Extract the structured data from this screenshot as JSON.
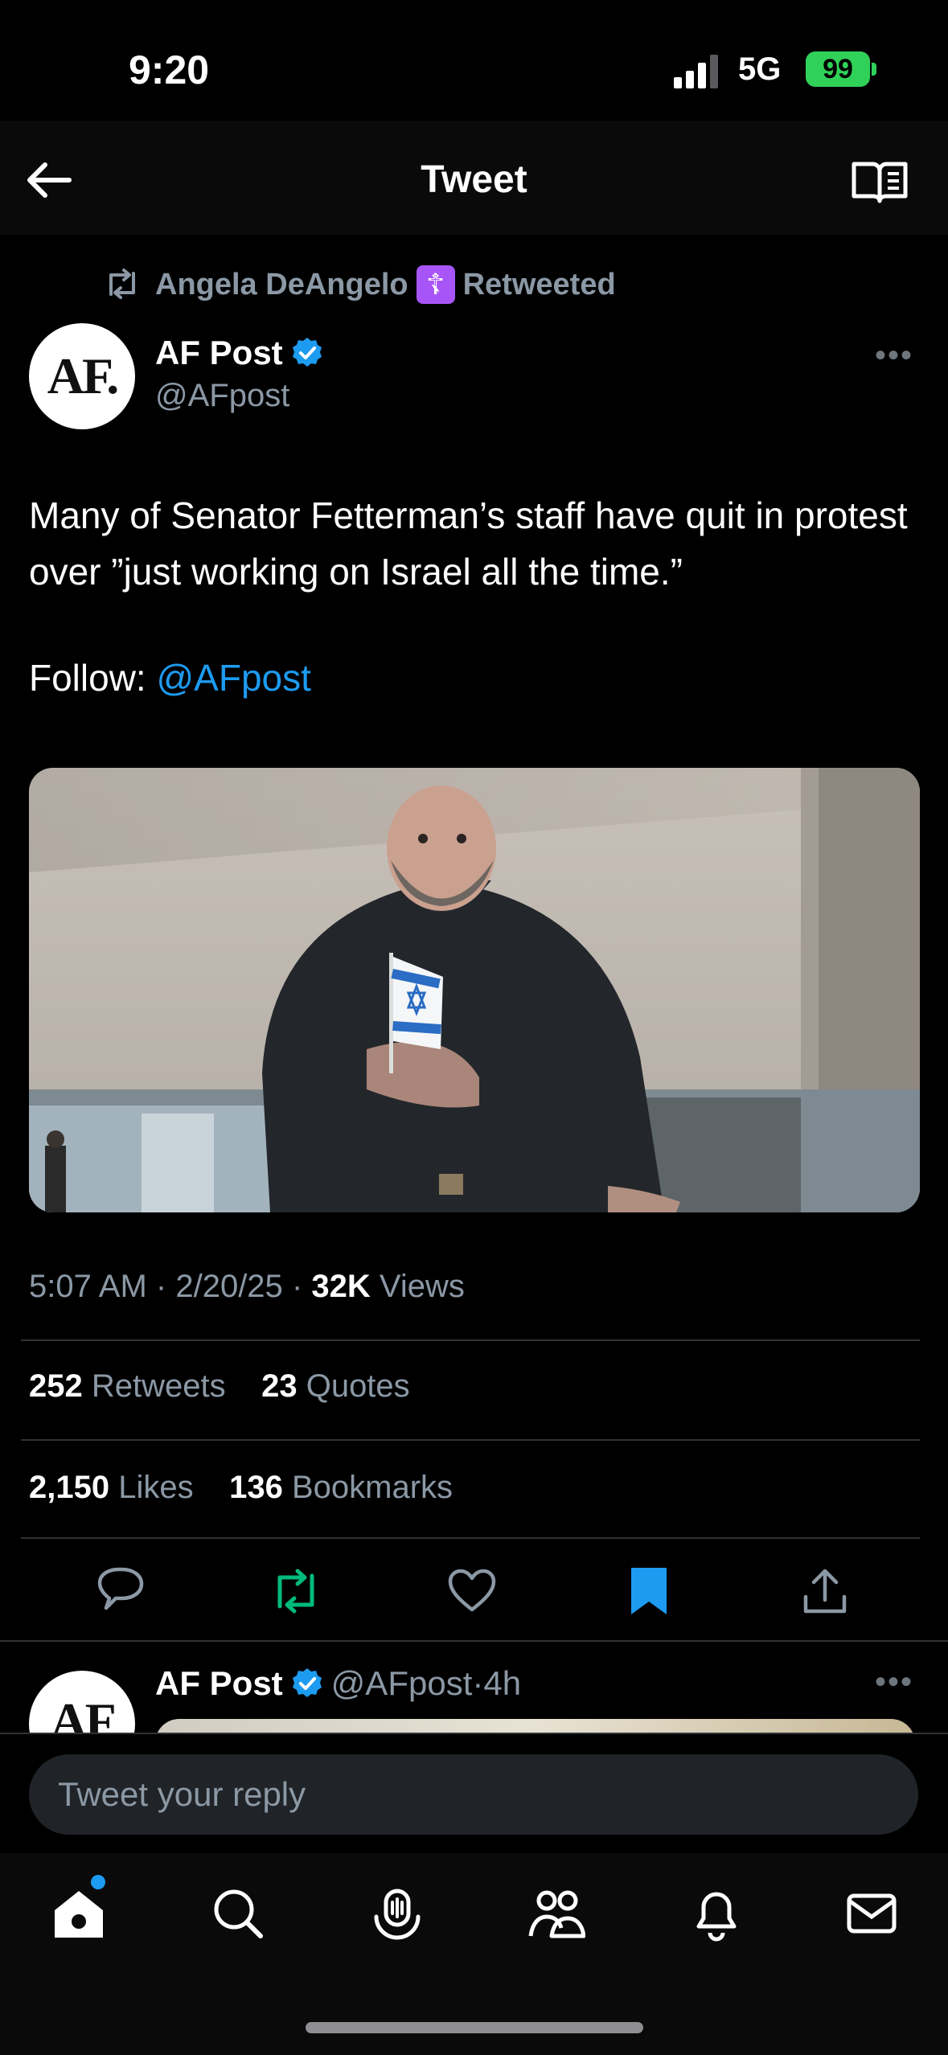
{
  "status_bar": {
    "time": "9:20",
    "network": "5G",
    "battery": "99"
  },
  "header": {
    "title": "Tweet"
  },
  "retweet": {
    "retweeter": "Angela DeAngelo",
    "badge": "☦",
    "label": "Retweeted"
  },
  "tweet": {
    "author_name": "AF Post",
    "author_handle": "@AFpost",
    "avatar_text": "AF.",
    "text": "Many of Senator Fetterman’s staff have quit in protest over ”just working on Israel all the time.”",
    "follow_prefix": "Follow: ",
    "follow_link": "@AFpost",
    "time": "5:07 AM",
    "date": "2/20/25",
    "views_count": "32K",
    "views_label": "Views",
    "sep": "·"
  },
  "stats": {
    "retweets_count": "252",
    "retweets_label": "Retweets",
    "quotes_count": "23",
    "quotes_label": "Quotes",
    "likes_count": "2,150",
    "likes_label": "Likes",
    "bookmarks_count": "136",
    "bookmarks_label": "Bookmarks"
  },
  "actions": [
    "reply-icon",
    "retweet-icon",
    "like-icon",
    "bookmark-icon",
    "share-icon"
  ],
  "reply_preview": {
    "author_name": "AF Post",
    "author_handle": "@AFpost",
    "sep": "·",
    "age": "4h",
    "avatar_text": "AF"
  },
  "reply_box": {
    "placeholder": "Tweet your reply"
  },
  "tabs": [
    "home-icon",
    "search-icon",
    "grok-icon",
    "communities-icon",
    "notifications-icon",
    "messages-icon"
  ],
  "colors": {
    "accent": "#1d9bf0",
    "retweet_green": "#00ba7c",
    "background": "#000000",
    "secondary_text": "#8b98a5"
  }
}
